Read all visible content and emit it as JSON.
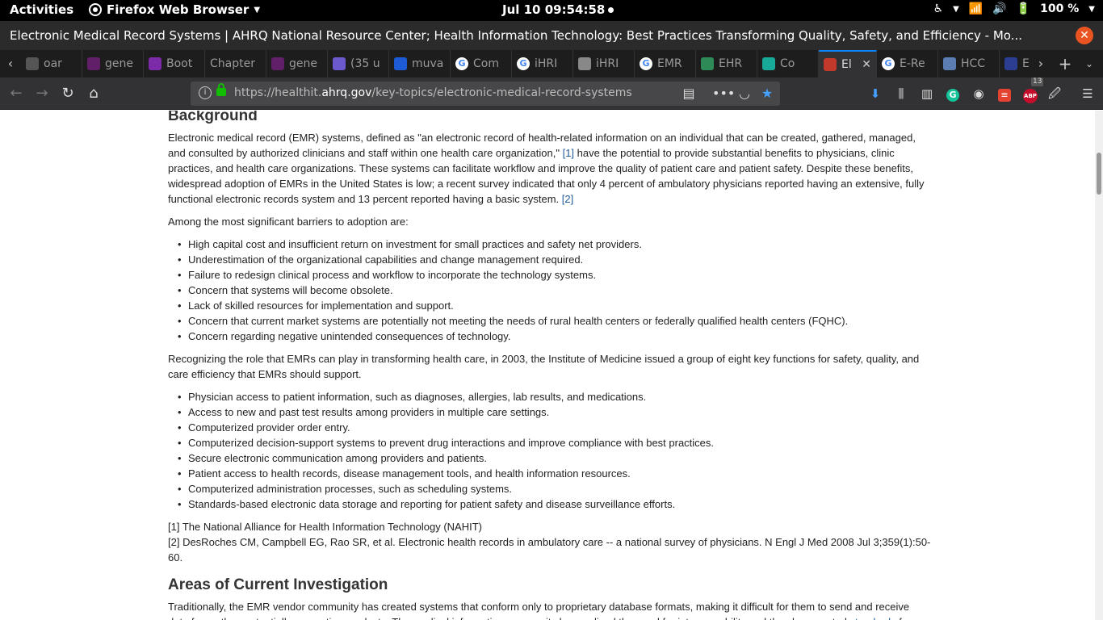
{
  "topbar": {
    "activities": "Activities",
    "app_name": "Firefox Web Browser",
    "clock": "Jul 10  09:54:58",
    "battery": "100 %"
  },
  "window": {
    "title": "Electronic Medical Record Systems | AHRQ National Resource Center; Health Information Technology: Best Practices Transforming Quality, Safety, and Efficiency - Mo..."
  },
  "tabs": [
    {
      "label": "oar",
      "icon": "generic-icon",
      "color": "#555"
    },
    {
      "label": "gene",
      "icon": "slack-icon",
      "color": "#611f69"
    },
    {
      "label": "Boot",
      "icon": "list-icon",
      "color": "#7c2aa8"
    },
    {
      "label": "Chapter",
      "icon": "none",
      "color": ""
    },
    {
      "label": "gene",
      "icon": "slack-icon",
      "color": "#611f69"
    },
    {
      "label": "(35 u",
      "icon": "mail-icon",
      "color": "#6a5acd"
    },
    {
      "label": "muva",
      "icon": "bookmark-icon",
      "color": "#1e5bd6"
    },
    {
      "label": "Com",
      "icon": "google-icon",
      "color": "#4285f4"
    },
    {
      "label": "iHRI",
      "icon": "google-icon",
      "color": "#4285f4"
    },
    {
      "label": "iHRI",
      "icon": "page-icon",
      "color": "#888"
    },
    {
      "label": "EMR",
      "icon": "google-icon",
      "color": "#4285f4"
    },
    {
      "label": "EHR",
      "icon": "leaf-icon",
      "color": "#2e8b57"
    },
    {
      "label": "Co",
      "icon": "circle-icon",
      "color": "#18a999"
    },
    {
      "label": "El",
      "icon": "ahrq-icon",
      "color": "#c0392b",
      "active": true
    },
    {
      "label": "E-Re",
      "icon": "google-icon",
      "color": "#4285f4"
    },
    {
      "label": "HCC",
      "icon": "doc-icon",
      "color": "#5b7db1"
    },
    {
      "label": "E-Re",
      "icon": "star-icon",
      "color": "#2c3e91"
    }
  ],
  "url": {
    "prefix": "https://healthit.",
    "host": "ahrq.gov",
    "path": "/key-topics/electronic-medical-record-systems"
  },
  "extensions": {
    "abp_badge": "13"
  },
  "page": {
    "background_heading": "Background",
    "intro_p1": "Electronic medical record (EMR) systems, defined as \"an electronic record of health-related information on an individual that can be created, gathered, managed, and consulted by authorized clinicians and staff within one health care organization,\" ",
    "ref1": "[1]",
    "intro_p2": "  have the potential to provide substantial benefits to physicians, clinic practices, and health care organizations. These systems can facilitate workflow and improve the quality of patient care and patient safety. Despite these benefits, widespread adoption of EMRs in the United States is low; a recent survey indicated that only 4 percent of ambulatory physicians reported having an extensive, fully functional electronic records system and 13 percent reported having a basic system. ",
    "ref2": "[2]",
    "barriers_intro": "Among the most significant barriers to adoption are:",
    "barriers": [
      "High capital cost and insufficient return on investment for small practices and safety net providers.",
      "Underestimation of the organizational capabilities and change management required.",
      "Failure to redesign clinical process and workflow to incorporate the technology systems.",
      "Concern that systems will become obsolete.",
      "Lack of skilled resources for implementation and support.",
      "Concern that current market systems are potentially not meeting the needs of rural health centers or federally qualified health centers (FQHC).",
      "Concern regarding negative unintended consequences of technology."
    ],
    "functions_intro": "Recognizing the role that EMRs can play in transforming health care, in 2003, the Institute of Medicine issued a group of eight key functions for safety, quality, and care efficiency that EMRs should support.",
    "functions": [
      "Physician access to patient information, such as diagnoses, allergies, lab results, and medications.",
      "Access to new and past test results among providers in multiple care settings.",
      "Computerized provider order entry.",
      "Computerized decision-support systems to prevent drug interactions and improve compliance with best practices.",
      "Secure electronic communication among providers and patients.",
      "Patient access to health records, disease management tools, and health information resources.",
      "Computerized administration processes, such as scheduling systems.",
      "Standards-based electronic data storage and reporting for patient safety and disease surveillance efforts."
    ],
    "footnote1": "[1] The National Alliance for Health Information Technology (NAHIT)",
    "footnote2": "[2] DesRoches CM, Campbell EG, Rao SR, et al. Electronic health records in ambulatory care -- a national survey of physicians. N Engl J Med  2008 Jul 3;359(1):50-60.",
    "areas_heading": "Areas of Current Investigation",
    "areas_p1": "Traditionally, the EMR vendor community has created systems that conform only to proprietary database formats, making it difficult for them to send and receive data from other, potentially competing products. The medical informatics community has realized the need for interoperability and thus has created ",
    "areas_link": "standards",
    "areas_p2": " for"
  }
}
